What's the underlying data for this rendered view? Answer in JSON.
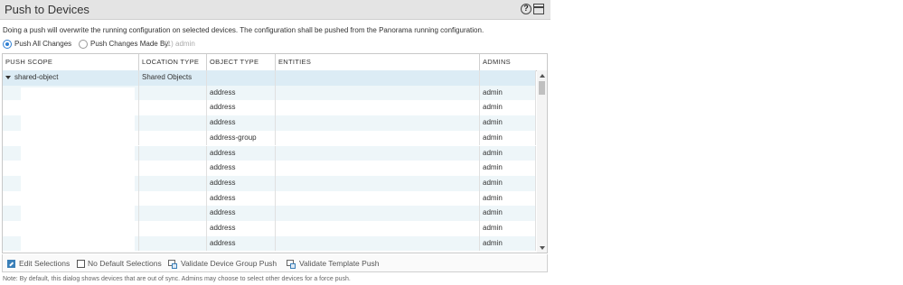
{
  "dialog": {
    "title": "Push to Devices",
    "description": "Doing a push will overwrite the running configuration on selected devices. The configuration shall be pushed from the Panorama running configuration.",
    "radio_all": "Push All Changes",
    "radio_by": "Push Changes Made By:",
    "radio_by_value": "(1) admin"
  },
  "table": {
    "columns": [
      "PUSH SCOPE",
      "LOCATION TYPE",
      "OBJECT TYPE",
      "ENTITIES",
      "ADMINS"
    ],
    "group": {
      "scope": "shared-object",
      "location": "Shared Objects"
    },
    "rows": [
      {
        "object_type": "address",
        "admin": "admin"
      },
      {
        "object_type": "address",
        "admin": "admin"
      },
      {
        "object_type": "address",
        "admin": "admin"
      },
      {
        "object_type": "address-group",
        "admin": "admin"
      },
      {
        "object_type": "address",
        "admin": "admin"
      },
      {
        "object_type": "address",
        "admin": "admin"
      },
      {
        "object_type": "address",
        "admin": "admin"
      },
      {
        "object_type": "address",
        "admin": "admin"
      },
      {
        "object_type": "address",
        "admin": "admin"
      },
      {
        "object_type": "address",
        "admin": "admin"
      },
      {
        "object_type": "address",
        "admin": "admin"
      }
    ]
  },
  "toolbar": {
    "edit": "Edit Selections",
    "no_default": "No Default Selections",
    "validate_dg": "Validate Device Group Push",
    "validate_tpl": "Validate Template Push"
  },
  "note": "Note: By default, this dialog shows devices that are out of sync. Admins may choose to select other devices for a force push."
}
